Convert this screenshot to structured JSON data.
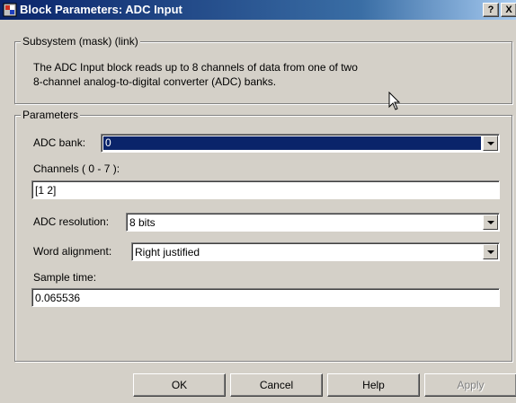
{
  "window": {
    "title": "Block Parameters: ADC Input",
    "help_button": "?",
    "close_button": "X"
  },
  "subsystem": {
    "legend": "Subsystem (mask) (link)",
    "description_line1": "The ADC Input block reads up to 8 channels of data from one of two",
    "description_line2": "8-channel analog-to-digital converter (ADC) banks."
  },
  "parameters": {
    "legend": "Parameters",
    "adc_bank": {
      "label": "ADC bank:",
      "value": "0"
    },
    "channels": {
      "label": "Channels ( 0 - 7 ):",
      "value": "[1 2]"
    },
    "adc_resolution": {
      "label": "ADC resolution:",
      "value": "8 bits"
    },
    "word_alignment": {
      "label": "Word alignment:",
      "value": "Right justified"
    },
    "sample_time": {
      "label": "Sample time:",
      "value": "0.065536"
    }
  },
  "buttons": {
    "ok": "OK",
    "cancel": "Cancel",
    "help": "Help",
    "apply": "Apply"
  },
  "colors": {
    "title_bar": "#0a246a",
    "dialog_face": "#d4d0c8",
    "selection": "#0a246a"
  },
  "icons": {
    "app": "simulink-block-icon",
    "combo_arrow": "chevron-down-icon",
    "cursor": "mouse-pointer-icon"
  }
}
